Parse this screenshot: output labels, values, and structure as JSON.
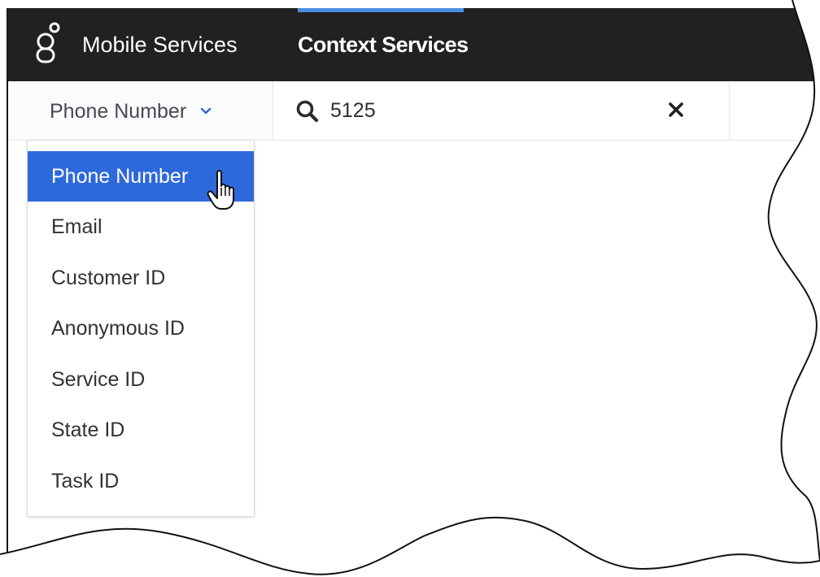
{
  "header": {
    "logo_icon": "genesys-logo-icon",
    "nav": [
      {
        "label": "Mobile Services",
        "active": false
      },
      {
        "label": "Context Services",
        "active": true
      }
    ],
    "accent_color": "#4a90e2",
    "background_color": "#212121"
  },
  "search_type": {
    "selected_label": "Phone Number",
    "chevron_icon": "chevron-down-icon"
  },
  "search": {
    "icon": "search-icon",
    "value": "5125",
    "clear_icon": "close-icon"
  },
  "dropdown": {
    "selected_color": "#2e69db",
    "items": [
      {
        "label": "Phone Number",
        "selected": true
      },
      {
        "label": "Email",
        "selected": false
      },
      {
        "label": "Customer ID",
        "selected": false
      },
      {
        "label": "Anonymous ID",
        "selected": false
      },
      {
        "label": "Service ID",
        "selected": false
      },
      {
        "label": "State ID",
        "selected": false
      },
      {
        "label": "Task ID",
        "selected": false
      }
    ]
  },
  "pointer": {
    "icon": "hand-pointer-icon"
  }
}
